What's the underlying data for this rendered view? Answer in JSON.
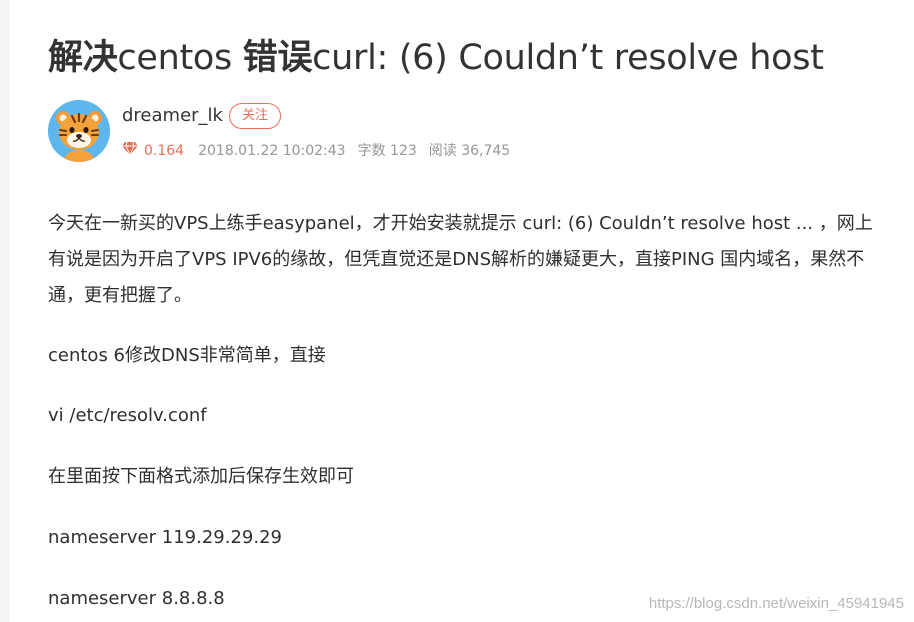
{
  "title": {
    "part1_bold": "解决",
    "part2": "centos ",
    "part3_bold": "错误",
    "part4": "curl: (6) Couldn’t resolve host"
  },
  "author": {
    "name": "dreamer_lk",
    "follow_label": "关注",
    "avatar_icon": "tiger-avatar-icon"
  },
  "meta": {
    "diamond_icon": "diamond-icon",
    "score": "0.164",
    "date": "2018.01.22 10:02:43",
    "words": "字数 123",
    "reads": "阅读 36,745"
  },
  "content": {
    "paragraph1": "今天在一新买的VPS上练手easypanel，才开始安装就提示 curl: (6) Couldn’t resolve host ... ，网上有说是因为开启了VPS IPV6的缘故，但凭直觉还是DNS解析的嫌疑更大，直接PING 国内域名，果然不通，更有把握了。",
    "paragraph2": "centos 6修改DNS非常简单，直接",
    "paragraph3": "vi /etc/resolv.conf",
    "paragraph4": "在里面按下面格式添加后保存生效即可",
    "paragraph5": "nameserver 119.29.29.29",
    "paragraph6": "nameserver 8.8.8.8"
  },
  "watermark": "https://blog.csdn.net/weixin_45941945",
  "colors": {
    "accent": "#ea6f5a",
    "meta_text": "#969696",
    "avatar_bg": "#59b6f0"
  }
}
